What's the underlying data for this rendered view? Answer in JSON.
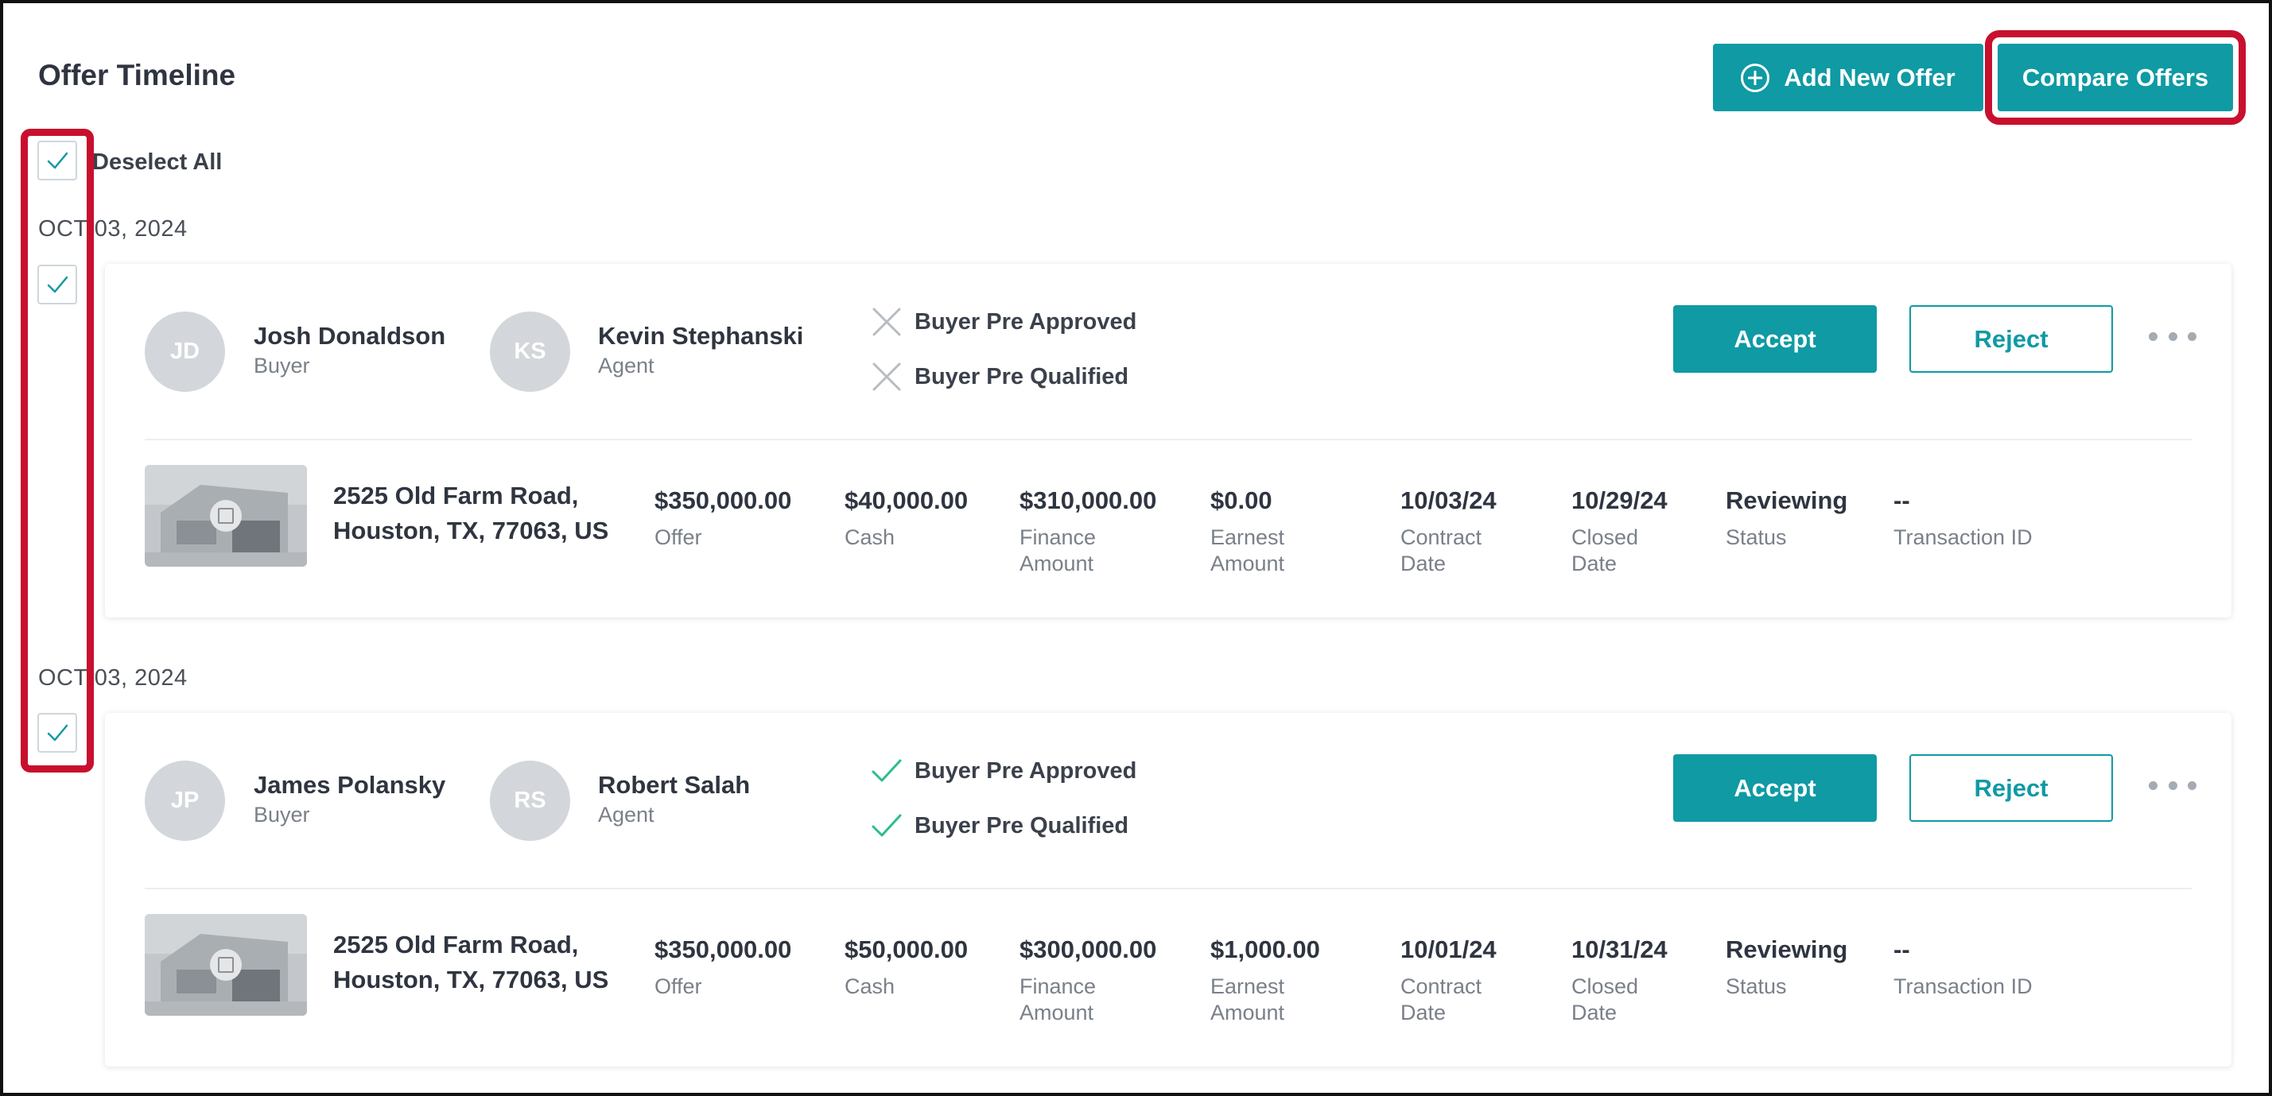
{
  "header": {
    "title": "Offer Timeline",
    "add_offer_label": "Add New Offer",
    "compare_offers_label": "Compare Offers"
  },
  "selection": {
    "deselect_all_label": "Deselect All",
    "all_selected": true
  },
  "colors": {
    "accent": "#0f9aa4",
    "highlight": "#c8102e",
    "approved_check": "#2bbd8f",
    "not_approved_x": "#b7bcc2"
  },
  "offers": [
    {
      "date": "OCT 03, 2024",
      "selected": true,
      "buyer": {
        "initials": "JD",
        "name": "Josh Donaldson",
        "role": "Buyer"
      },
      "agent": {
        "initials": "KS",
        "name": "Kevin Stephanski",
        "role": "Agent"
      },
      "pre_approved": {
        "label": "Buyer Pre Approved",
        "status": "no",
        "icon": "x-icon"
      },
      "pre_qualified": {
        "label": "Buyer Pre Qualified",
        "status": "no",
        "icon": "x-icon"
      },
      "accept_label": "Accept",
      "reject_label": "Reject",
      "address_line1": "2525 Old Farm Road,",
      "address_line2": "Houston, TX, 77063, US",
      "offer": {
        "value": "$350,000.00",
        "label": "Offer"
      },
      "cash": {
        "value": "$40,000.00",
        "label": "Cash"
      },
      "finance": {
        "value": "$310,000.00",
        "label": "Finance Amount"
      },
      "earnest": {
        "value": "$0.00",
        "label": "Earnest Amount"
      },
      "contract_date": {
        "value": "10/03/24",
        "label": "Contract Date"
      },
      "closed_date": {
        "value": "10/29/24",
        "label": "Closed Date"
      },
      "status": {
        "value": "Reviewing",
        "label": "Status"
      },
      "transaction_id": {
        "value": "--",
        "label": "Transaction ID"
      }
    },
    {
      "date": "OCT 03, 2024",
      "selected": true,
      "buyer": {
        "initials": "JP",
        "name": "James Polansky",
        "role": "Buyer"
      },
      "agent": {
        "initials": "RS",
        "name": "Robert Salah",
        "role": "Agent"
      },
      "pre_approved": {
        "label": "Buyer Pre Approved",
        "status": "yes",
        "icon": "check-icon"
      },
      "pre_qualified": {
        "label": "Buyer Pre Qualified",
        "status": "yes",
        "icon": "check-icon"
      },
      "accept_label": "Accept",
      "reject_label": "Reject",
      "address_line1": "2525 Old Farm Road,",
      "address_line2": "Houston, TX, 77063, US",
      "offer": {
        "value": "$350,000.00",
        "label": "Offer"
      },
      "cash": {
        "value": "$50,000.00",
        "label": "Cash"
      },
      "finance": {
        "value": "$300,000.00",
        "label": "Finance Amount"
      },
      "earnest": {
        "value": "$1,000.00",
        "label": "Earnest Amount"
      },
      "contract_date": {
        "value": "10/01/24",
        "label": "Contract Date"
      },
      "closed_date": {
        "value": "10/31/24",
        "label": "Closed Date"
      },
      "status": {
        "value": "Reviewing",
        "label": "Status"
      },
      "transaction_id": {
        "value": "--",
        "label": "Transaction ID"
      }
    }
  ]
}
